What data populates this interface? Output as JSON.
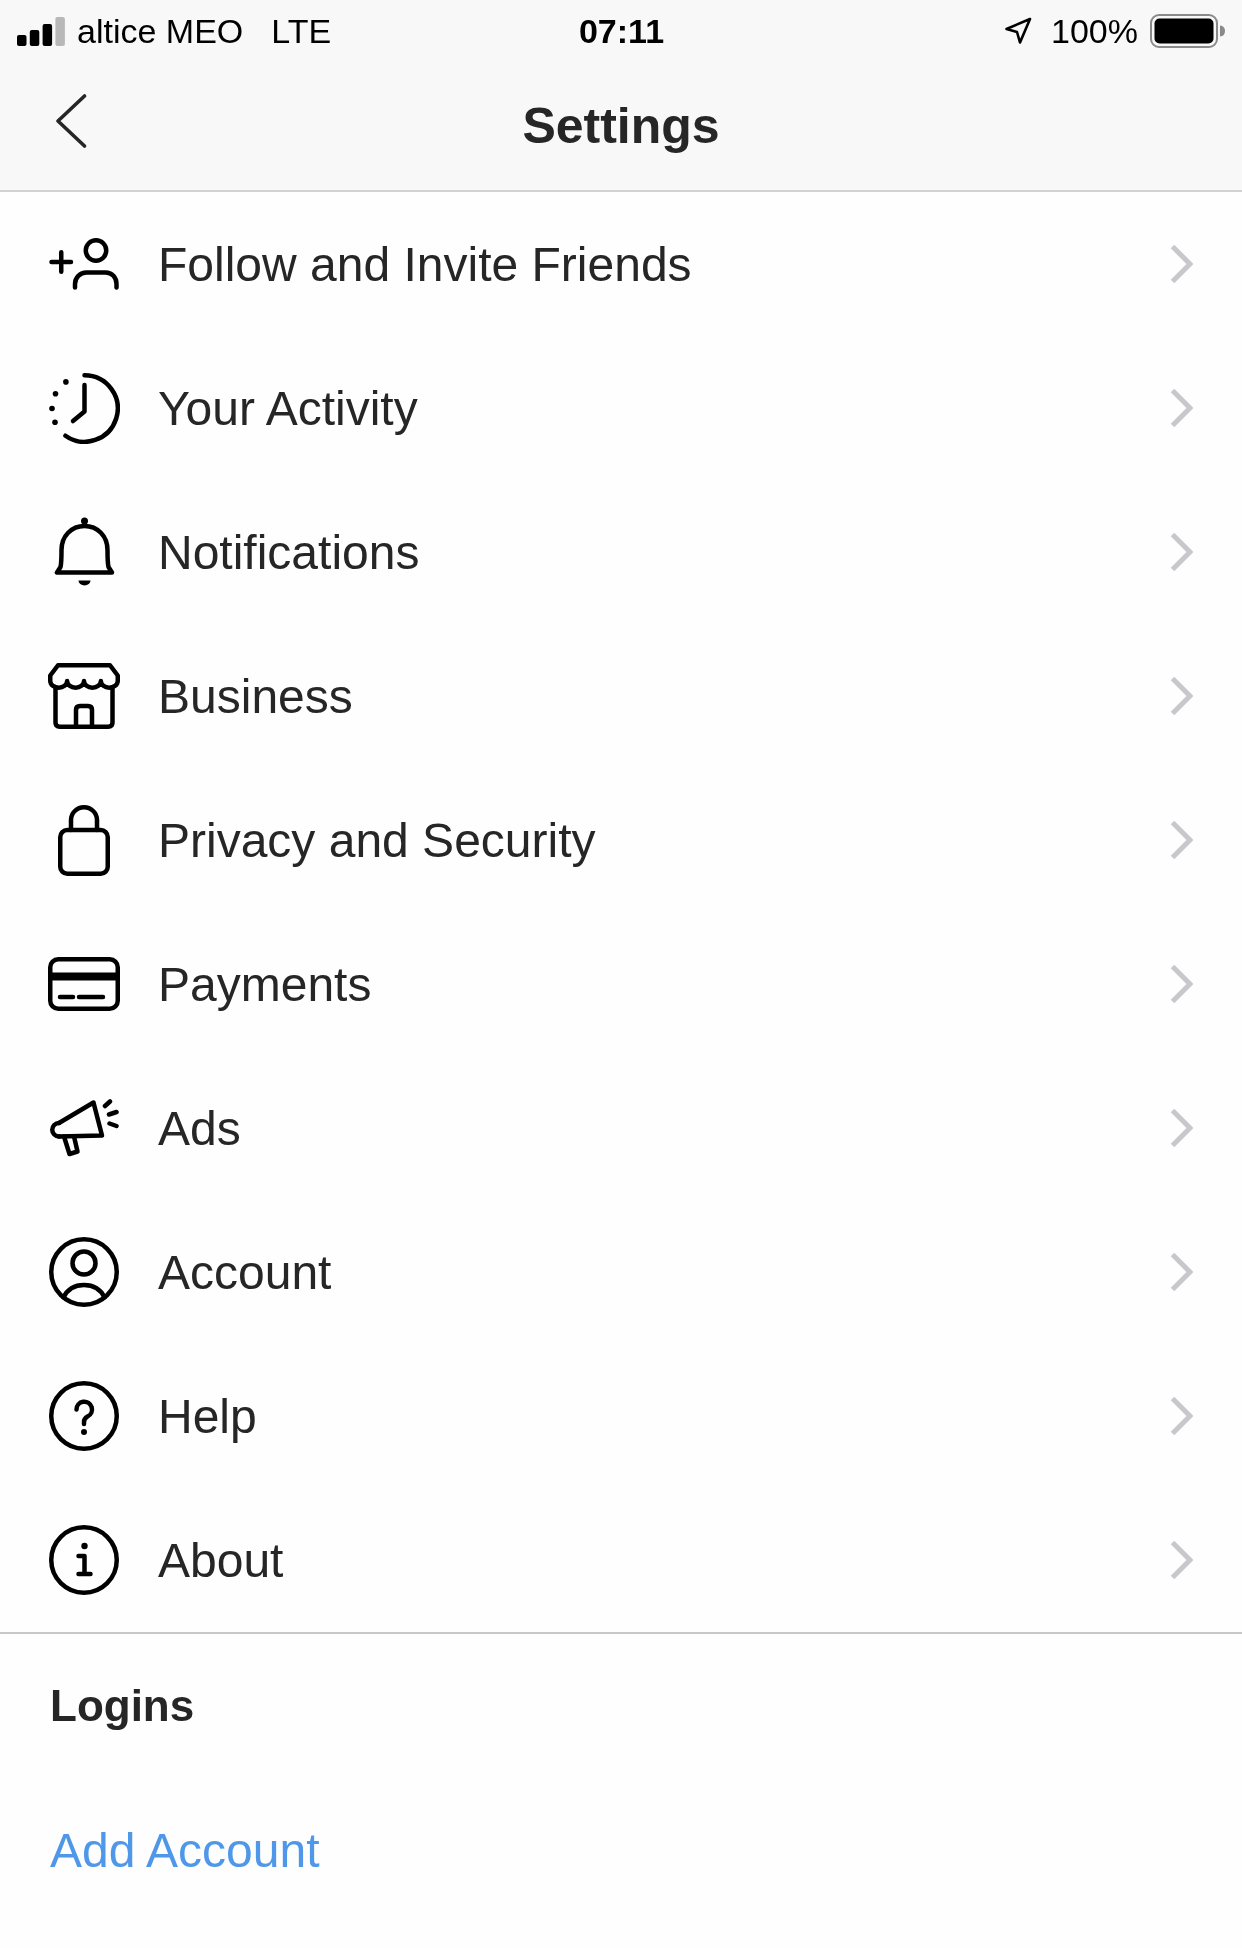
{
  "status_bar": {
    "carrier": "altice MEO",
    "network": "LTE",
    "time": "07:11",
    "battery": "100%"
  },
  "nav_bar": {
    "title": "Settings"
  },
  "menu_items": [
    {
      "label": "Follow and Invite Friends"
    },
    {
      "label": "Your Activity"
    },
    {
      "label": "Notifications"
    },
    {
      "label": "Business"
    },
    {
      "label": "Privacy and Security"
    },
    {
      "label": "Payments"
    },
    {
      "label": "Ads"
    },
    {
      "label": "Account"
    },
    {
      "label": "Help"
    },
    {
      "label": "About"
    }
  ],
  "logins": {
    "title": "Logins",
    "link": "Add Account"
  }
}
